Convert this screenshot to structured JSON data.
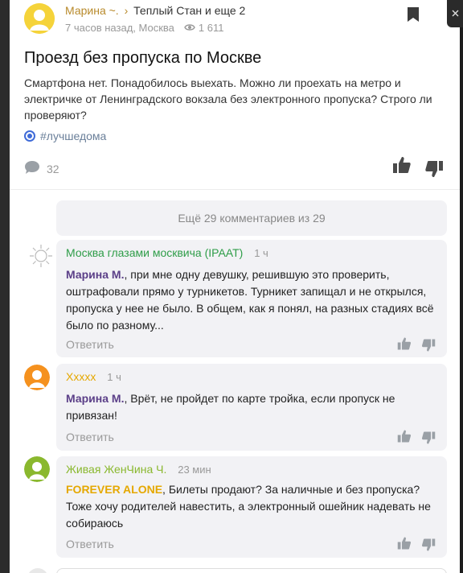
{
  "post": {
    "author": "Марина ~.",
    "author_separator": "›",
    "location": "Теплый Стан и еще 2",
    "time": "7 часов назад, Москва",
    "views": "1 611",
    "title": "Проезд без пропуска по Москве",
    "body": "Смартфона нет. Понадобилось выехать. Можно ли проехать на метро и электричке от Ленинградского вокзала без электронного пропуска? Строго ли проверяют?",
    "tag": "#лучшедома",
    "comments_count": "32"
  },
  "more_comments_label": "Ещё 29 комментариев из 29",
  "comments": [
    {
      "author": "Москва глазами москвича (IPAAT)",
      "author_color": "#2e9d48",
      "time": "1 ч",
      "mention": "Марина М.",
      "text": ", при мне одну девушку, решившую это проверить, оштрафовали прямо у турникетов. Турникет запищал и не открылся, пропуска у нее не было. В общем, как я понял, на разных стадиях всё было по разному...",
      "reply": "Ответить"
    },
    {
      "author": "Xxxxx",
      "author_color": "#e5a800",
      "time": "1 ч",
      "mention": "Марина М.",
      "text": ", Врёт, не пройдет по карте тройка, если пропуск не привязан!",
      "reply": "Ответить"
    },
    {
      "author": "Живая ЖенЧина Ч.",
      "author_color": "#8ab82e",
      "time": "23 мин",
      "mention": "FOREVER ALONE",
      "text": ", Билеты продают? За наличные и без пропуска? Тоже хочу родителей навестить, а электронный ошейник надевать не собираюсь",
      "reply": "Ответить"
    }
  ],
  "colors": {
    "accent_blue": "#3f6bd8",
    "avatar_yellow": "#f5d33a",
    "avatar_orange": "#f5911e",
    "avatar_green": "#8ab82e"
  },
  "icons": {
    "bookmark": "bookmark-icon",
    "views": "eye-icon",
    "comments": "speech-bubble-icon",
    "like": "thumbs-up-icon",
    "dislike": "thumbs-down-icon"
  }
}
